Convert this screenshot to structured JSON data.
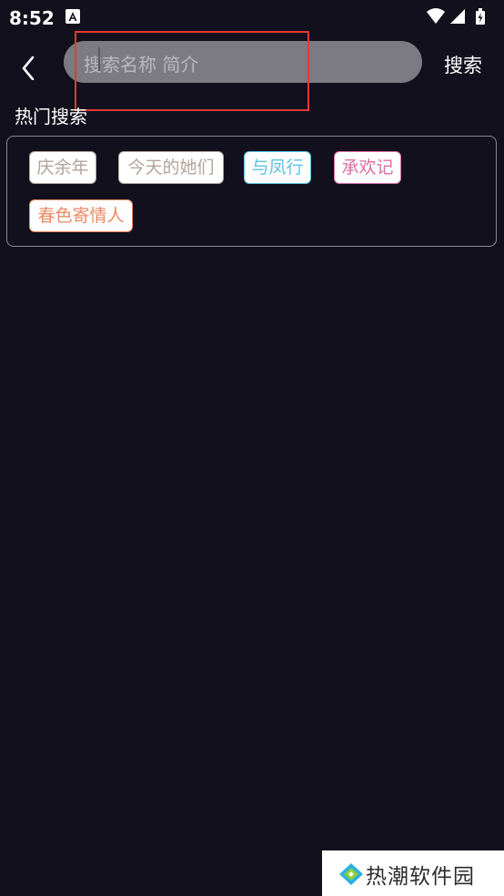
{
  "status_bar": {
    "time": "8:52",
    "notification_icon": "app-notification-icon"
  },
  "search": {
    "placeholder": "搜索名称 简介",
    "button_label": "搜索"
  },
  "hot": {
    "title": "热门搜索",
    "tags": [
      {
        "label": "庆余年",
        "color": "#b3a49b"
      },
      {
        "label": "今天的她们",
        "color": "#b3a49b"
      },
      {
        "label": "与凤行",
        "color": "#5cc3e3"
      },
      {
        "label": "承欢记",
        "color": "#dc6ea6"
      },
      {
        "label": "春色寄情人",
        "color": "#ec8a64"
      }
    ]
  },
  "watermark": {
    "text": "热潮软件园"
  }
}
